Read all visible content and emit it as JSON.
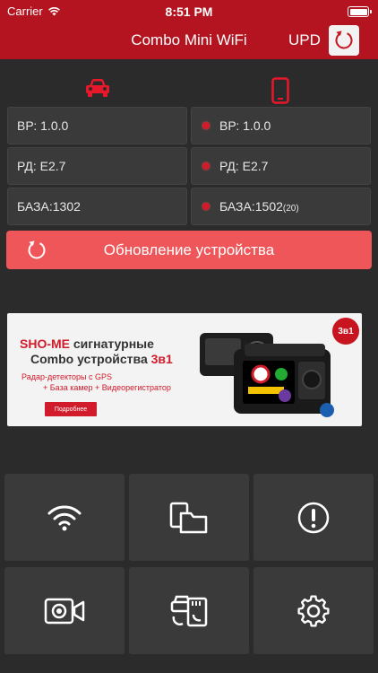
{
  "status_bar": {
    "carrier": "Carrier",
    "time": "8:51 PM"
  },
  "nav": {
    "title": "Combo Mini WiFi",
    "upd_label": "UPD",
    "refresh_icon": "refresh-icon"
  },
  "columns": {
    "left_icon": "car-icon",
    "right_icon": "phone-icon"
  },
  "device_info": [
    {
      "label": "ВР: 1.0.0"
    },
    {
      "label": "РД: E2.7"
    },
    {
      "label": "БАЗА:1302"
    }
  ],
  "app_info": [
    {
      "label": "ВР: 1.0.0",
      "suffix": ""
    },
    {
      "label": "РД: E2.7",
      "suffix": ""
    },
    {
      "label": "БАЗА:1502",
      "suffix": "(20)"
    }
  ],
  "update_button": {
    "label": "Обновление устройства"
  },
  "banner": {
    "title_brand": "SHO-ME",
    "title_rest": " сигнатурные",
    "title2_main": "Combo устройства ",
    "title2_red": "3в1",
    "line1": "Радар-детекторы с GPS",
    "line2": "+ База камер + Видеорегистратор",
    "button": "Подробнее",
    "badge": "3в1"
  },
  "tiles": [
    {
      "icon": "wifi-icon"
    },
    {
      "icon": "files-icon"
    },
    {
      "icon": "alert-icon"
    },
    {
      "icon": "camera-icon"
    },
    {
      "icon": "car-sd-icon"
    },
    {
      "icon": "settings-gear-icon"
    }
  ],
  "colors": {
    "bar": "#b3141f",
    "accent": "#ef5659",
    "bg": "#2b2b2b",
    "cell": "#3a3a3a",
    "dot": "#d11a2a"
  }
}
